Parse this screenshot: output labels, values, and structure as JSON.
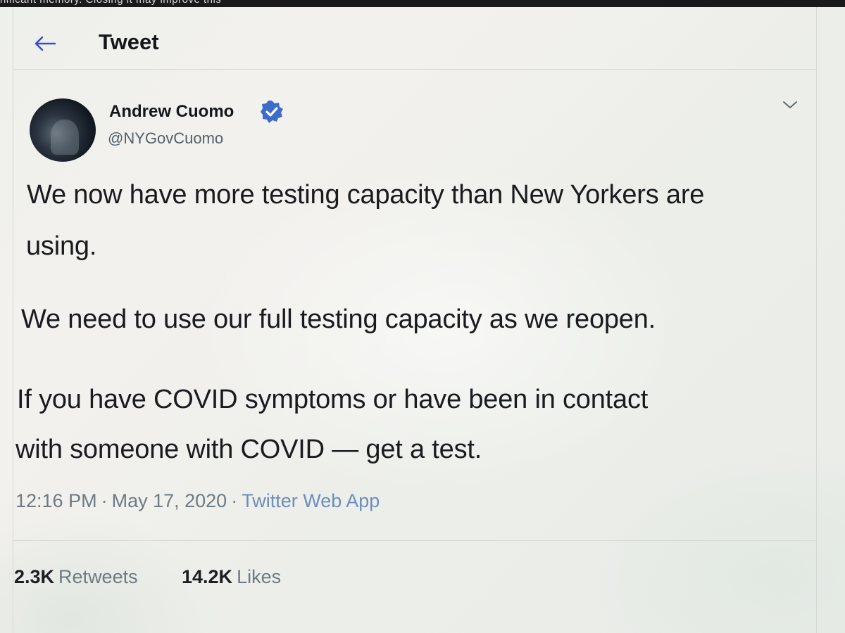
{
  "top_strip": {
    "text": "nificant memory. Closing it may improve this"
  },
  "header": {
    "title": "Tweet",
    "back_icon": "arrow-left-icon"
  },
  "tweet": {
    "author_name": "Andrew Cuomo",
    "author_handle": "@NYGovCuomo",
    "verified": true,
    "body_lines": [
      "We now have more testing capacity than New Yorkers are",
      "using.",
      "We need to use our full testing capacity as we reopen.",
      "If you have COVID symptoms or have been in contact",
      "with someone with COVID — get a test."
    ],
    "time": "12:16 PM",
    "date": "May 17, 2020",
    "source": "Twitter Web App",
    "separator": "·",
    "retweets_count": "2.3K",
    "retweets_label": "Retweets",
    "likes_count": "14.2K",
    "likes_label": "Likes"
  },
  "colors": {
    "accent": "#1da1f2",
    "verified": "#1da1f2",
    "text_primary": "#14171a",
    "text_secondary": "#657786"
  },
  "icons": {
    "back": "arrow-left-icon",
    "verified": "verified-badge-icon",
    "more": "chevron-down-icon"
  }
}
